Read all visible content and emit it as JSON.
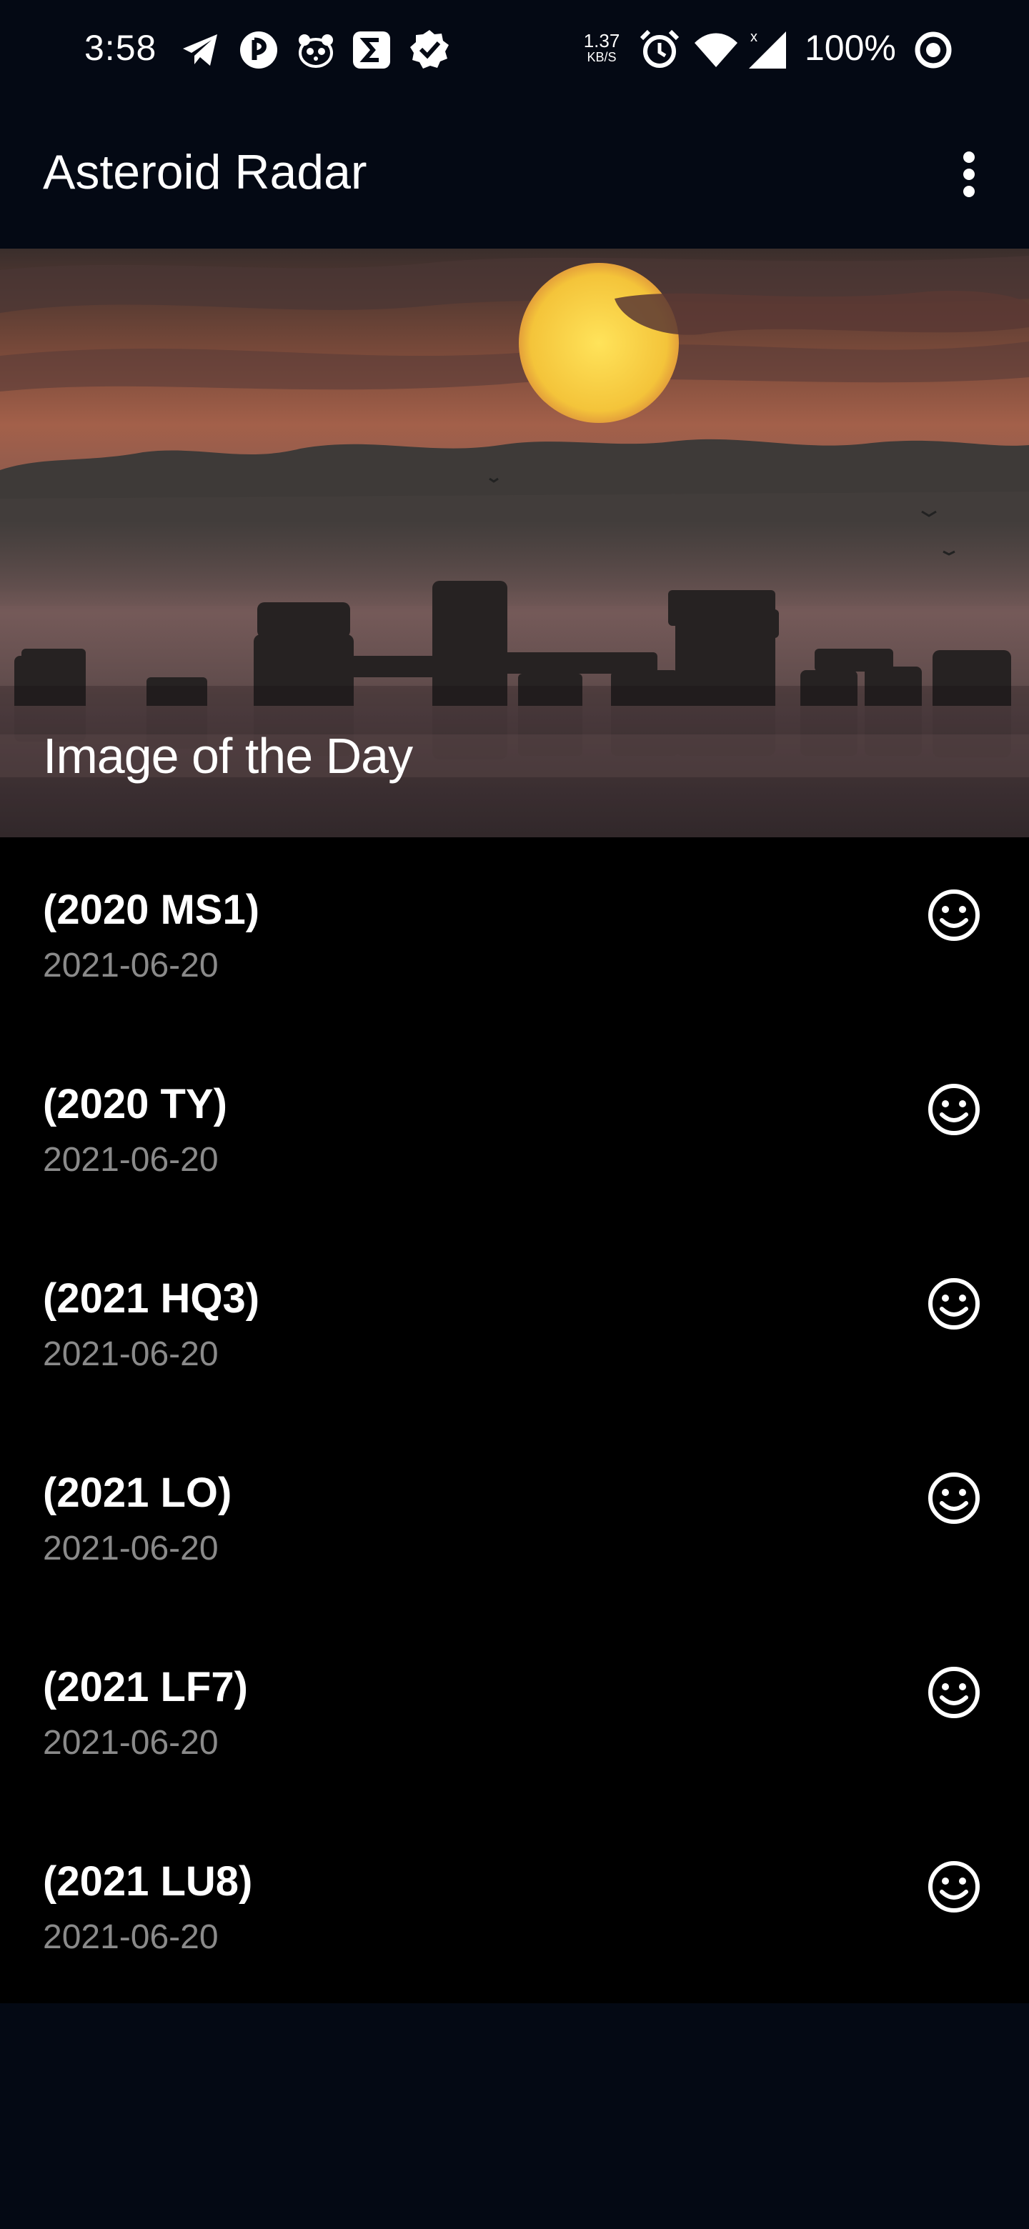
{
  "status_bar": {
    "time": "3:58",
    "network_speed_value": "1.37",
    "network_speed_unit": "KB/S",
    "battery": "100%",
    "left_icons": [
      "telegram-icon",
      "pocket-casts-icon",
      "panda-icon",
      "sigma-icon",
      "check-badge-icon"
    ],
    "right_icons": [
      "alarm-icon",
      "wifi-icon",
      "signal-icon",
      "battery-icon"
    ]
  },
  "app_bar": {
    "title": "Asteroid Radar",
    "menu_icon": "more-vert-icon"
  },
  "image_of_day": {
    "caption": "Image of the Day"
  },
  "asteroids": [
    {
      "name": "(2020 MS1)",
      "date": "2021-06-20",
      "icon": "smile-icon"
    },
    {
      "name": "(2020 TY)",
      "date": "2021-06-20",
      "icon": "smile-icon"
    },
    {
      "name": "(2021 HQ3)",
      "date": "2021-06-20",
      "icon": "smile-icon"
    },
    {
      "name": "(2021 LO)",
      "date": "2021-06-20",
      "icon": "smile-icon"
    },
    {
      "name": "(2021 LF7)",
      "date": "2021-06-20",
      "icon": "smile-icon"
    },
    {
      "name": "(2021 LU8)",
      "date": "2021-06-20",
      "icon": "smile-icon"
    }
  ],
  "colors": {
    "background": "#040914",
    "list_background": "#000000",
    "date_text": "#8a8a8a"
  }
}
